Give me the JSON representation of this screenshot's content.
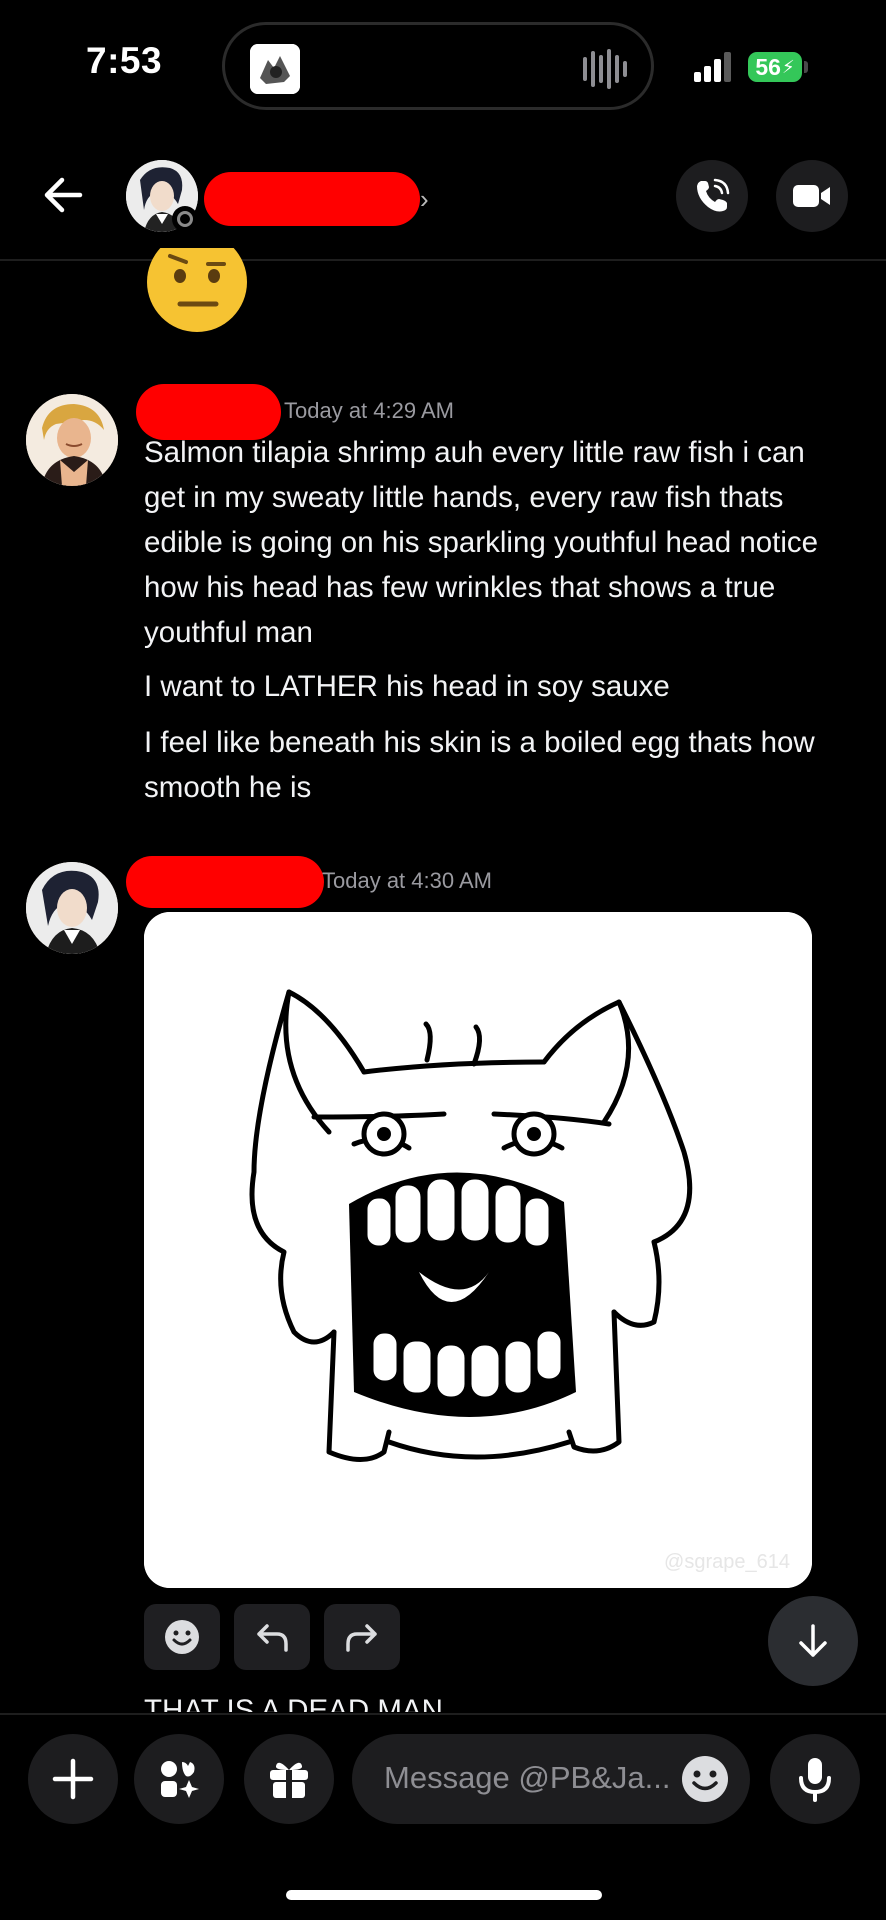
{
  "status_bar": {
    "time": "7:53",
    "battery": "56"
  },
  "header": {
    "back_icon": "arrow-left-icon",
    "chevron": "›",
    "call_icon": "phone-icon",
    "video_icon": "video-camera-icon"
  },
  "messages": [
    {
      "timestamp": "Today at 4:29 AM",
      "lines": [
        "Salmon tilapia shrimp auh every little raw fish i can get in my sweaty little hands, every raw fish thats edible is going on his sparkling youthful head notice how his head has few wrinkles that shows a true youthful man",
        "I want to LATHER his head in soy sauxe",
        "I feel like beneath his skin is a boiled egg thats how smooth he is"
      ]
    },
    {
      "timestamp": "Today at 4:30 AM",
      "image_watermark": "@sgrape_614",
      "actions": [
        "add-reaction-icon",
        "reply-icon",
        "forward-icon"
      ]
    }
  ],
  "partial_message": "THAT IS A DEAD MAN",
  "composer": {
    "placeholder": "Message @PB&Ja...",
    "icons": [
      "plus-icon",
      "apps-icon",
      "gift-icon",
      "emoji-icon",
      "microphone-icon"
    ]
  },
  "colors": {
    "background": "#000000",
    "redaction": "#ff0000",
    "battery": "#34c759",
    "button_bg": "#1d1d1f"
  }
}
